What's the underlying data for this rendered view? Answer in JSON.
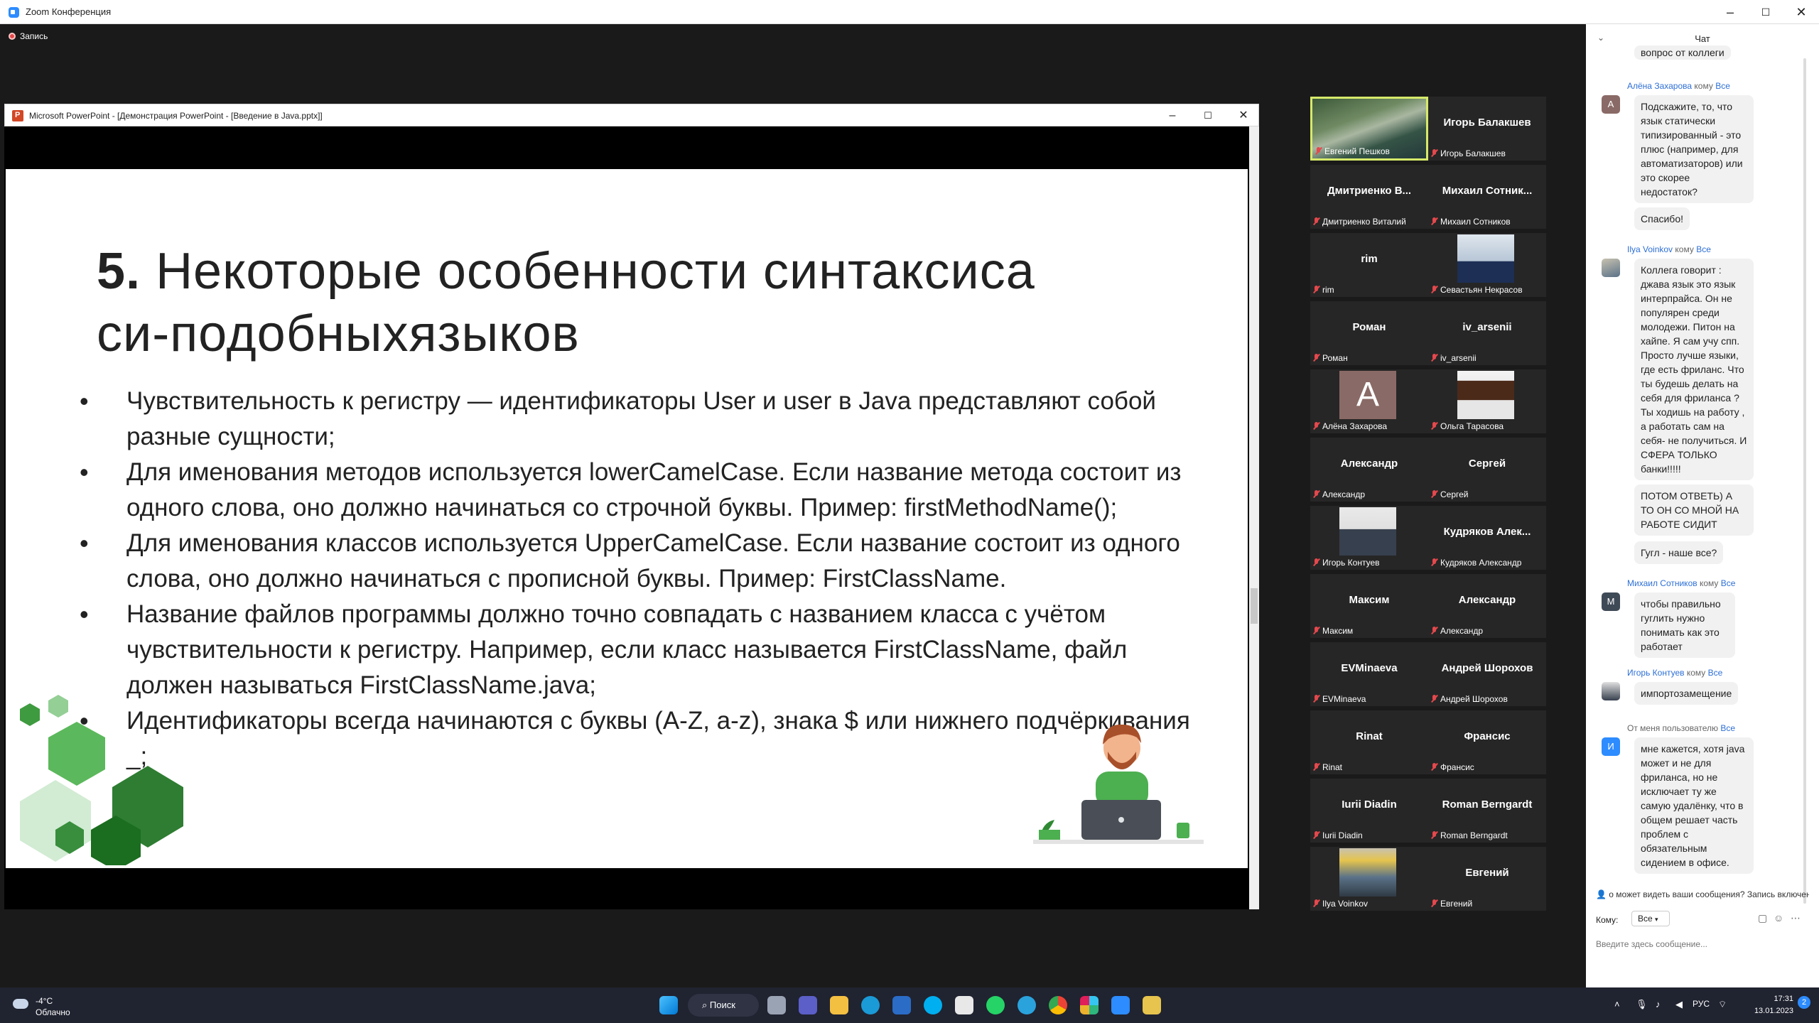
{
  "zoom": {
    "window_title": "Zoom Конференция",
    "recording_label": "Запись"
  },
  "ppt": {
    "window_title": "Microsoft PowerPoint - [Демонстрация PowerPoint - [Введение в Java.pptx]]",
    "slide": {
      "title_number": "5.",
      "title_line1": "Некоторые особенности синтаксиса",
      "title_line2": "си-подобныхязыков",
      "bullets": [
        "Чувствительность к регистру — идентификаторы User и user в Java представляют собой разные сущности;",
        "Для именования методов используется lowerCamelCase. Если название метода состоит из одного слова, оно должно начинаться со строчной буквы. Пример: firstMethodName();",
        "Для именования классов используется UpperCamelCase. Если название состоит из одного слова, оно должно начинаться с прописной буквы. Пример: FirstClassName.",
        "Название файлов программы должно точно совпадать с названием класса с учётом чувствительности к регистру. Например, если класс называется FirstClassName, файл должен называться FirstClassName.java;",
        "Идентификаторы всегда начинаются с буквы (A-Z, a-z), знака $ или нижнего подчёркивания _;"
      ]
    }
  },
  "participants": [
    {
      "name": "",
      "label": "Евгений Пешков",
      "video": "photo-self",
      "speaking": true
    },
    {
      "name": "Игорь Балакшев",
      "label": "Игорь Балакшев"
    },
    {
      "name": "Дмитриенко В...",
      "label": "Дмитриенко Виталий"
    },
    {
      "name": "Михаил Сотник...",
      "label": "Михаил Сотников"
    },
    {
      "name": "rim",
      "label": "rim"
    },
    {
      "name": "",
      "label": "Севастьян Некрасов",
      "video": "photo-man1"
    },
    {
      "name": "Роман",
      "label": "Роман"
    },
    {
      "name": "iv_arsenii",
      "label": "iv_arsenii"
    },
    {
      "name": "",
      "label": "Алёна Захарова",
      "video": "avatar-A",
      "initial": "A"
    },
    {
      "name": "",
      "label": "Ольга Тарасова",
      "video": "photo-woman"
    },
    {
      "name": "Александр",
      "label": "Александр"
    },
    {
      "name": "Сергей",
      "label": "Сергей"
    },
    {
      "name": "",
      "label": "Игорь Контуев",
      "video": "photo-man2"
    },
    {
      "name": "Кудряков Алек...",
      "label": "Кудряков Александр"
    },
    {
      "name": "Максим",
      "label": "Максим"
    },
    {
      "name": "Александр",
      "label": "Александр"
    },
    {
      "name": "EVMinaeva",
      "label": "EVMinaeva"
    },
    {
      "name": "Андрей Шорохов",
      "label": "Андрей Шорохов"
    },
    {
      "name": "Rinat",
      "label": "Rinat"
    },
    {
      "name": "Франсис",
      "label": "Франсис"
    },
    {
      "name": "Iurii Diadin",
      "label": "Iurii Diadin"
    },
    {
      "name": "Roman Berngardt",
      "label": "Roman Berngardt"
    },
    {
      "name": "",
      "label": "Ilya Voinkov",
      "video": "photo-man3"
    },
    {
      "name": "Евгений",
      "label": "Евгений"
    }
  ],
  "chat": {
    "title": "Чат",
    "to_word": "кому",
    "all_word": "Все",
    "top_cut": "вопрос от коллеги",
    "m1_sender": "Алёна Захарова",
    "m1_initial": "A",
    "m1_text1": "Подскажите, то, что язык статически типизированный - это плюс (например, для автоматизаторов) или это скорее недостаток?",
    "m1_text2": "Спасибо!",
    "m2_sender": "Ilya Voinkov",
    "m2_text1": "Коллега говорит : джава язык это язык интерпрайса. Он не популярен среди молодежи. Питон на хайпе. Я сам учу спп. Просто лучше языки, где есть фриланс. Что ты будешь делать на себя для фриланса ? Ты ходишь на работу , а работать сам на себя- не получиться. И СФЕРА ТОЛЬКО банки!!!!!",
    "m2_text2": "ПОТОМ ОТВЕТЬ) А ТО ОН СО МНОЙ НА РАБОТЕ СИДИТ",
    "m2_text3": "Гугл - наше все?",
    "m3_sender": "Михаил Сотников",
    "m3_initial": "M",
    "m3_text": "чтобы правильно гуглить нужно понимать как это работает",
    "m4_sender": "Игорь Контуев",
    "m4_text": "импортозамещение",
    "m5_sender": "От меня пользователю",
    "m5_initial": "И",
    "m5_text": "мне кажется, хотя java может и не для фриланса, но не исключает ту же самую удалёнку, что в общем решает часть проблем с обязательным сидением в офисе.",
    "notice": "о может видеть ваши сообщения? Запись включен",
    "to_label": "Кому:",
    "to_value": "Все",
    "input_placeholder": "Введите здесь сообщение..."
  },
  "taskbar": {
    "temp": "-4°C",
    "weather": "Облачно",
    "search_label": "Поиск",
    "lang": "РУС",
    "time": "17:31",
    "date": "13.01.2023",
    "notif_count": "2"
  },
  "colors": {
    "zoom_accent": "#2d8cff",
    "chat_sender": "#2d6fd6",
    "speaking_border": "#d6e96a",
    "mute_red": "#e5484d",
    "slide_green": "#4caf50"
  }
}
